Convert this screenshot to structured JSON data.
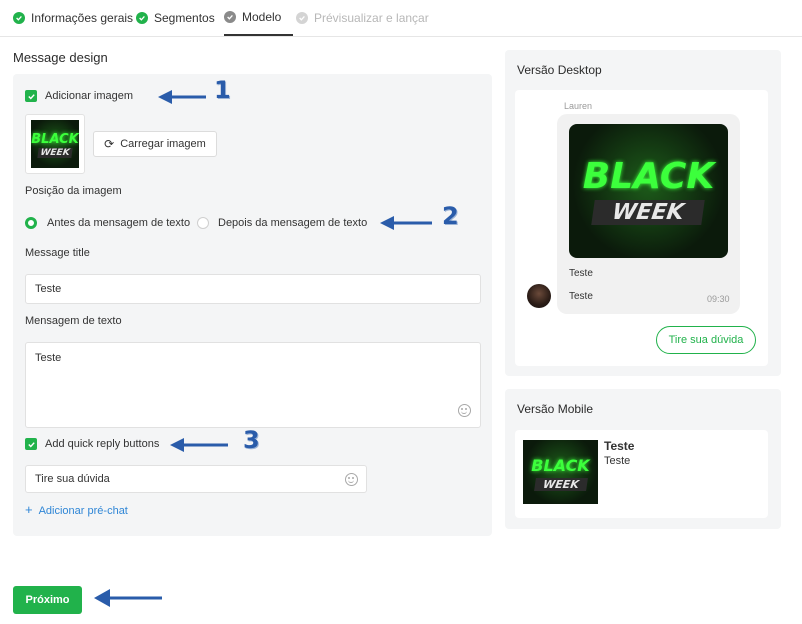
{
  "stepper": {
    "steps": [
      {
        "label": "Informações gerais",
        "state": "done"
      },
      {
        "label": "Segmentos",
        "state": "done"
      },
      {
        "label": "Modelo",
        "state": "active"
      },
      {
        "label": "Prévisualizar e lançar",
        "state": "pending"
      }
    ]
  },
  "design": {
    "title": "Message design",
    "add_image_label": "Adicionar imagem",
    "add_image_checked": true,
    "upload_button": "Carregar imagem",
    "image_position_label": "Posição da imagem",
    "position_options": [
      {
        "label": "Antes da mensagem de texto",
        "selected": true
      },
      {
        "label": "Depois da mensagem de texto",
        "selected": false
      }
    ],
    "message_title_label": "Message title",
    "message_title_value": "Teste",
    "text_label": "Mensagem de texto",
    "text_value": "Teste",
    "quick_reply_label": "Add quick reply buttons",
    "quick_reply_checked": true,
    "quick_reply_value": "Tire sua dúvida",
    "add_prechat_link": "Adicionar pré-chat"
  },
  "image_art": {
    "line1": "BLACK",
    "line2": "WEEK"
  },
  "annotations": [
    "1",
    "2",
    "3"
  ],
  "next_button": "Próximo",
  "desktop_preview": {
    "title": "Versão Desktop",
    "sender": "Lauren",
    "title_text": "Teste",
    "body_text": "Teste",
    "time": "09:30",
    "quick_reply": "Tire sua dúvida"
  },
  "mobile_preview": {
    "title": "Versão Mobile",
    "title_text": "Teste",
    "body_text": "Teste"
  },
  "colors": {
    "accent": "#21b24b",
    "link": "#2f86d6",
    "annotation": "#2a5caa"
  }
}
